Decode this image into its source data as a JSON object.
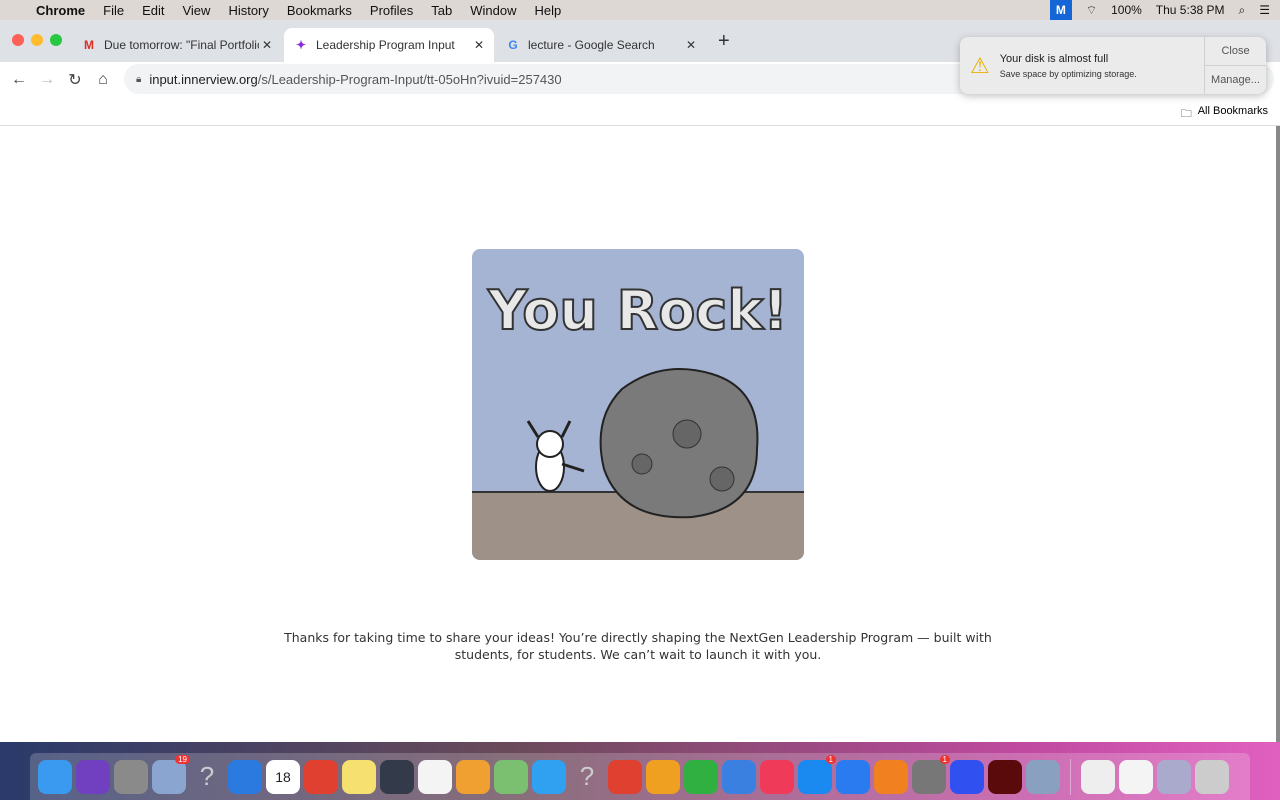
{
  "menubar": {
    "app": "Chrome",
    "items": [
      "File",
      "Edit",
      "View",
      "History",
      "Bookmarks",
      "Profiles",
      "Tab",
      "Window",
      "Help"
    ],
    "battery": "100%",
    "clock": "Thu 5:38 PM"
  },
  "tabs": [
    {
      "title": "Due tomorrow: \"Final Portfolio\"",
      "icon": "M"
    },
    {
      "title": "Leadership Program Input",
      "icon": "✦"
    },
    {
      "title": "lecture - Google Search",
      "icon": "G"
    }
  ],
  "url": {
    "host": "input.innerview.org",
    "path": "/s/Leadership-Program-Input/tt-05oHn?ivuid=257430"
  },
  "bookmarks": {
    "all": "All Bookmarks"
  },
  "notification": {
    "title": "Your disk is almost full",
    "body": "Save space by optimizing storage.",
    "close": "Close",
    "manage": "Manage..."
  },
  "page": {
    "image_text": "You Rock!",
    "message_line1": "Thanks for taking  time to share your ideas! You’re directly shaping the NextGen Leadership Program — built with",
    "message_line2": "students, for students. We can’t wait to launch it with you."
  },
  "dock": [
    {
      "name": "finder",
      "color": "#3a9af0"
    },
    {
      "name": "siri",
      "color": "#7040c0"
    },
    {
      "name": "launchpad",
      "color": "#8a8a8a"
    },
    {
      "name": "mail-preview",
      "color": "#8aa6d0",
      "badge": "19"
    },
    {
      "name": "unknown",
      "color": "transparent",
      "glyph": "?"
    },
    {
      "name": "safari",
      "color": "#2a7ae0"
    },
    {
      "name": "calendar",
      "color": "#ffffff",
      "glyph": "18"
    },
    {
      "name": "chrome",
      "color": "#e04030"
    },
    {
      "name": "notes",
      "color": "#f5e070"
    },
    {
      "name": "quicktime",
      "color": "#333a4a"
    },
    {
      "name": "reminders",
      "color": "#f4f4f4"
    },
    {
      "name": "photos",
      "color": "#f0a030"
    },
    {
      "name": "maps",
      "color": "#7ac070"
    },
    {
      "name": "messages",
      "color": "#30a0f0"
    },
    {
      "name": "unknown",
      "color": "transparent",
      "glyph": "?"
    },
    {
      "name": "chrome",
      "color": "#e04030"
    },
    {
      "name": "pages",
      "color": "#f0a020"
    },
    {
      "name": "numbers",
      "color": "#30b040"
    },
    {
      "name": "keynote",
      "color": "#3a80e0"
    },
    {
      "name": "music",
      "color": "#f03a5a"
    },
    {
      "name": "app-store",
      "color": "#1a8af0",
      "badge": "1"
    },
    {
      "name": "zoom",
      "color": "#2a7af0"
    },
    {
      "name": "books",
      "color": "#f08020"
    },
    {
      "name": "system-preferences",
      "color": "#777",
      "badge": "1"
    },
    {
      "name": "roblox",
      "color": "#3050f0"
    },
    {
      "name": "flash",
      "color": "#5a0a0a"
    },
    {
      "name": "preview",
      "color": "#8aa0c0"
    },
    {
      "name": "png-file",
      "color": "#eee"
    },
    {
      "name": "screenshot",
      "color": "#f4f4f4"
    },
    {
      "name": "screenshot-folder",
      "color": "#aac"
    },
    {
      "name": "trash",
      "color": "#ccc"
    }
  ]
}
